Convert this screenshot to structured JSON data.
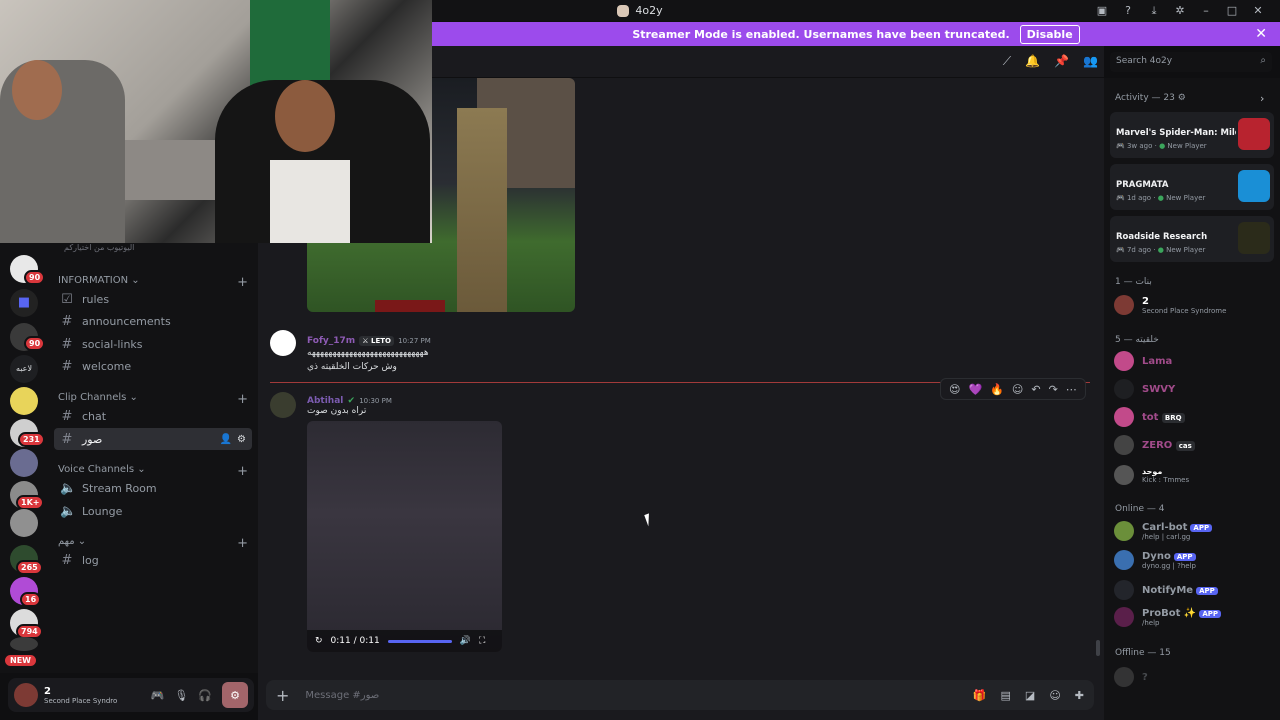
{
  "window": {
    "title": "4o2y"
  },
  "banner": {
    "text": "Streamer Mode is enabled. Usernames have been truncated.",
    "button": "Disable"
  },
  "search": {
    "placeholder": "Search 4o2y"
  },
  "rail": {
    "badges": [
      "90",
      "90",
      "231",
      "1K+",
      "265",
      "16",
      "794"
    ],
    "new_label": "NEW",
    "label_ar": "لاعبه"
  },
  "channels": {
    "top_item": "اليوتيوب من اختياركم",
    "categories": [
      {
        "name": "INFORMATION",
        "items": [
          "rules",
          "announcements",
          "social-links",
          "welcome"
        ]
      },
      {
        "name": "Clip Channels",
        "items": [
          "chat",
          "صور"
        ]
      },
      {
        "name": "Voice Channels",
        "items": [
          "Stream Room",
          "Lounge"
        ]
      },
      {
        "name": "مهم",
        "items": [
          "log"
        ]
      }
    ]
  },
  "user": {
    "name": "2",
    "status": "Second Place Syndro"
  },
  "messages": [
    {
      "user": "Fofy_17m",
      "tag": "LETO",
      "time": "10:27 PM",
      "line1": "ههههههههههههههههههههههههههههه",
      "line2": "وش حركات الخلقيته ذي"
    },
    {
      "user": "Abtihal",
      "time": "10:30 PM",
      "line1": "تراه بدون صوت"
    }
  ],
  "video": {
    "time": "0:11 / 0:11"
  },
  "composer": {
    "placeholder": "Message #صور"
  },
  "activity": {
    "header": "Activity — 23",
    "items": [
      {
        "title": "Marvel's Spider-Man: Mile...",
        "ago": "3w ago",
        "tag": "New Player"
      },
      {
        "title": "PRAGMATA",
        "ago": "1d ago",
        "tag": "New Player"
      },
      {
        "title": "Roadside Research",
        "ago": "7d ago",
        "tag": "New Player"
      }
    ]
  },
  "members": {
    "group1": "بنات — 1",
    "g1": [
      {
        "name": "2",
        "status": "Second Place Syndrome"
      }
    ],
    "group2": "خلقيته — 5",
    "g2": [
      {
        "name": "Lama"
      },
      {
        "name": "SWVY"
      },
      {
        "name": "tot",
        "tag": "BRQ"
      },
      {
        "name": "ZERO",
        "tag": "cas"
      },
      {
        "name": "موحد",
        "status": "Kick : Tmmes"
      }
    ],
    "online": "Online — 4",
    "bots": [
      {
        "name": "Carl-bot",
        "status": "/help | carl.gg",
        "tag": "APP"
      },
      {
        "name": "Dyno",
        "status": "dyno.gg | ?help",
        "tag": "APP"
      },
      {
        "name": "NotifyMe",
        "tag": "APP"
      },
      {
        "name": "ProBot",
        "status": "/help",
        "tag": "APP"
      }
    ],
    "offline": "Offline — 15",
    "offline_first": "?"
  },
  "colors": {
    "accent": "#5865f2",
    "banner": "#9c4bec",
    "danger": "#da373c"
  }
}
